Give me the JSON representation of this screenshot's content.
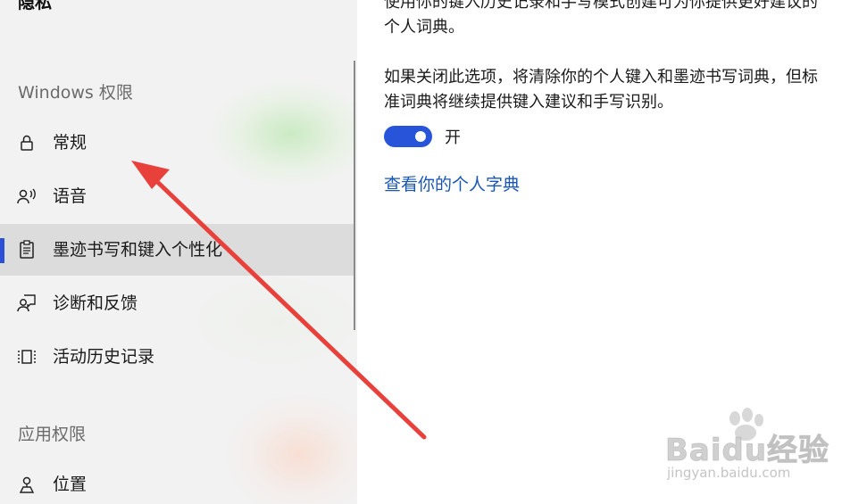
{
  "sidebar": {
    "section_title": "隐私",
    "windows_permissions_header": "Windows 权限",
    "app_permissions_header": "应用权限",
    "items": [
      {
        "label": "常规",
        "icon": "lock-icon"
      },
      {
        "label": "语音",
        "icon": "speech-icon"
      },
      {
        "label": "墨迹书写和键入个性化",
        "icon": "clipboard-icon",
        "selected": true
      },
      {
        "label": "诊断和反馈",
        "icon": "feedback-icon"
      },
      {
        "label": "活动历史记录",
        "icon": "timeline-icon"
      },
      {
        "label": "位置",
        "icon": "location-icon"
      }
    ]
  },
  "content": {
    "para1_line1": "使用你的键入历史记录和手写模式创建可为你提供更好建议的",
    "para1_line2": "个人词典。",
    "para2_line1": "如果关闭此选项，将清除你的个人键入和墨迹书写词典，但标",
    "para2_line2": "准词典将继续提供键入建议和手写识别。",
    "toggle": {
      "state": "on",
      "label": "开"
    },
    "link": "查看你的个人字典"
  },
  "watermark": {
    "brand": "Baidu经验",
    "url": "jingyan.baidu.com"
  },
  "colors": {
    "accent": "#2754d9",
    "link": "#1a57b5",
    "arrow": "#e8413c",
    "selection_indicator": "#2b4fd6"
  }
}
